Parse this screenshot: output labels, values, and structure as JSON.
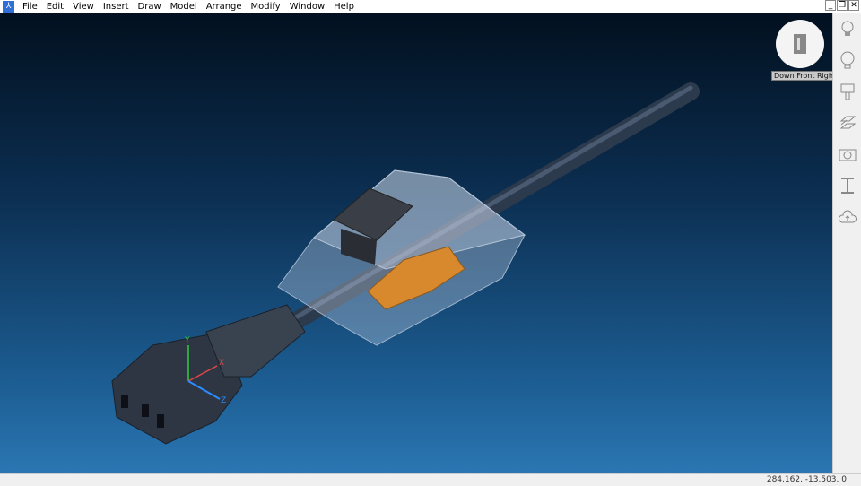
{
  "menubar": {
    "items": [
      "File",
      "Edit",
      "View",
      "Insert",
      "Draw",
      "Model",
      "Arrange",
      "Modify",
      "Window",
      "Help"
    ]
  },
  "window_controls": {
    "minimize": "_",
    "restore": "❐",
    "close": "✕"
  },
  "viewport": {
    "view_label": "Down Front Right",
    "axes": {
      "x": "X",
      "y": "Y",
      "z": "Z"
    }
  },
  "right_panel": {
    "icons": [
      "lightbulb-icon",
      "balloon-icon",
      "paint-brush-icon",
      "layers-icon",
      "camera-icon",
      "i-beam-icon",
      "cloud-upload-icon"
    ]
  },
  "statusbar": {
    "command": ":",
    "coordinates": "284.162, -13.503, 0"
  },
  "colors": {
    "accent": "#2f6fd6",
    "orange": "#d8892e"
  }
}
